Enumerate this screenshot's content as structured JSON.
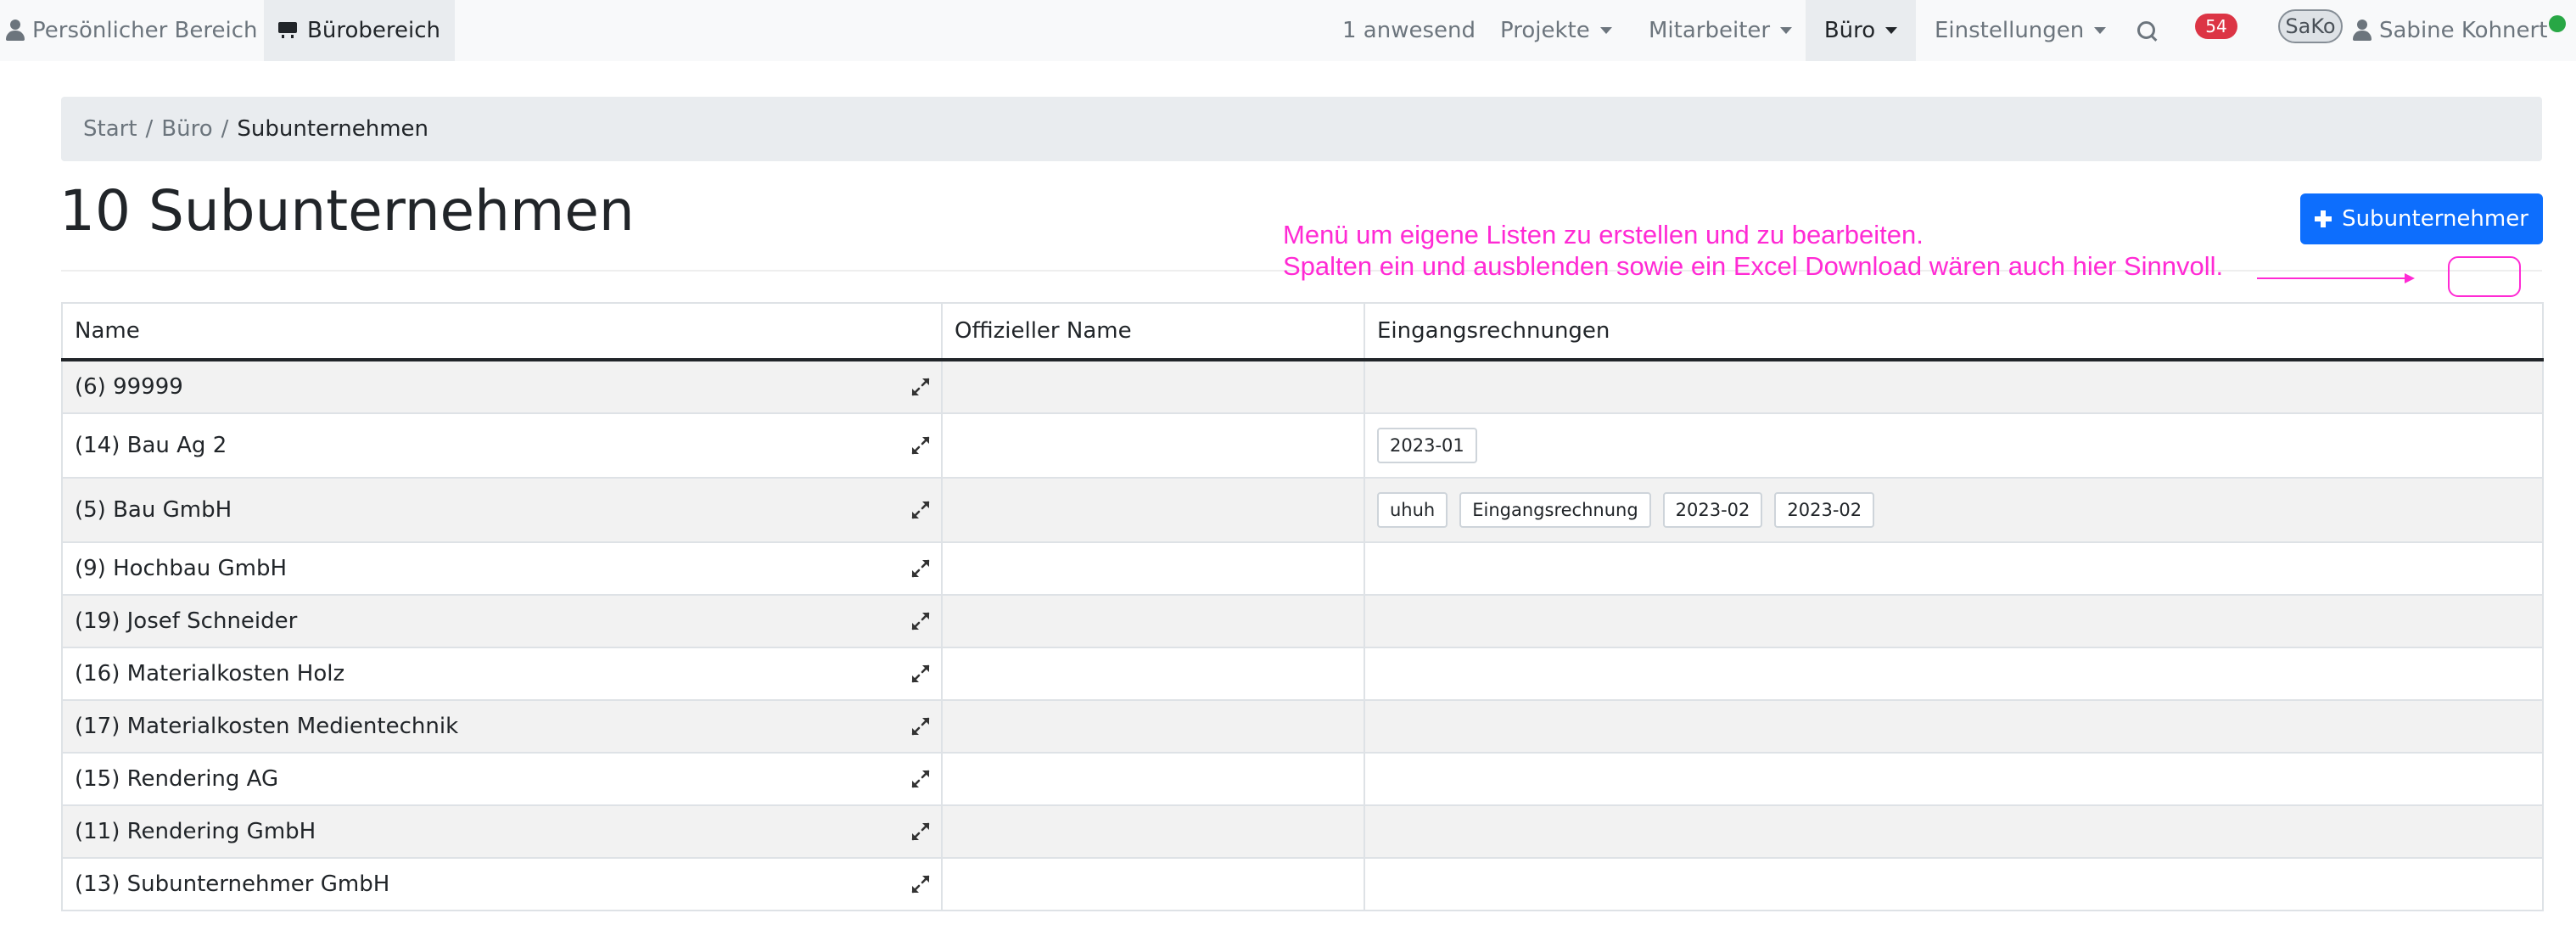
{
  "nav": {
    "personal": "Persönlicher Bereich",
    "office": "Bürobereich",
    "present": "1 anwesend",
    "projects": "Projekte",
    "staff": "Mitarbeiter",
    "buero": "Büro",
    "settings": "Einstellungen",
    "notification_count": "54",
    "avatar_initials": "SaKo",
    "user_name": "Sabine Kohnert"
  },
  "breadcrumb": [
    "Start",
    "Büro",
    "Subunternehmen"
  ],
  "page": {
    "title": "10 Subunternehmen",
    "add_button": "Subunternehmer"
  },
  "annotation": {
    "line1": "Menü um eigene Listen zu erstellen und zu bearbeiten.",
    "line2": "Spalten ein und ausblenden sowie ein Excel Download wären auch hier Sinnvoll."
  },
  "table": {
    "headers": [
      "Name",
      "Offizieller Name",
      "Eingangsrechnungen"
    ],
    "rows": [
      {
        "name": "(6) 99999",
        "official": "",
        "invoices": []
      },
      {
        "name": "(14) Bau Ag 2",
        "official": "",
        "invoices": [
          "2023-01"
        ]
      },
      {
        "name": "(5) Bau GmbH",
        "official": "",
        "invoices": [
          "uhuh",
          "Eingangsrechnung",
          "2023-02",
          "2023-02"
        ]
      },
      {
        "name": "(9) Hochbau GmbH",
        "official": "",
        "invoices": []
      },
      {
        "name": "(19) Josef Schneider",
        "official": "",
        "invoices": []
      },
      {
        "name": "(16) Materialkosten Holz",
        "official": "",
        "invoices": []
      },
      {
        "name": "(17) Materialkosten Medientechnik",
        "official": "",
        "invoices": []
      },
      {
        "name": "(15) Rendering AG",
        "official": "",
        "invoices": []
      },
      {
        "name": "(11) Rendering GmbH",
        "official": "",
        "invoices": []
      },
      {
        "name": "(13) Subunternehmer GmbH",
        "official": "",
        "invoices": []
      }
    ]
  },
  "colors": {
    "primary": "#0d6efd",
    "badge": "#dc3545",
    "annotation": "#ff2ad4",
    "online": "#28a745"
  }
}
